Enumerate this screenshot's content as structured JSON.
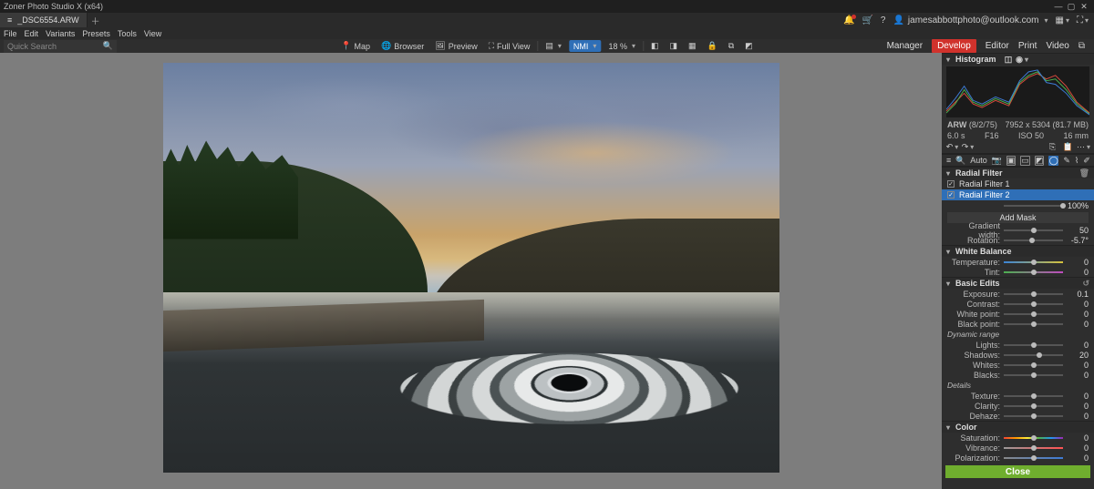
{
  "titlebar": {
    "app": "Zoner Photo Studio X (x64)"
  },
  "tab": {
    "filename": "_DSC6554.ARW"
  },
  "menu": [
    "File",
    "Edit",
    "Variants",
    "Presets",
    "Tools",
    "View"
  ],
  "search": {
    "placeholder": "Quick Search"
  },
  "center_tools": {
    "map": "Map",
    "browser": "Browser",
    "preview": "Preview",
    "fullview": "Full View",
    "zoom_pct": "18 %",
    "color_mode": "NMI"
  },
  "account": {
    "email": "jamesabbottphoto@outlook.com"
  },
  "modes": {
    "manager": "Manager",
    "develop": "Develop",
    "editor": "Editor",
    "print": "Print",
    "video": "Video"
  },
  "side": {
    "histogram_title": "Histogram",
    "file_meta": {
      "format": "ARW",
      "bits": "(8/2/75)",
      "dims": "7952 x 5304 (81.7 MB)",
      "shutter": "6.0 s",
      "aperture": "F16",
      "iso": "ISO 50",
      "focal": "16 mm"
    },
    "tool_auto": "Auto",
    "radial": {
      "title": "Radial Filter",
      "items": [
        "Radial Filter 1",
        "Radial Filter 2"
      ],
      "strength": "100%",
      "add_mask": "Add Mask",
      "gradient_width": {
        "label": "Gradient width:",
        "value": "50"
      },
      "rotation": {
        "label": "Rotation:",
        "value": "-5.7°"
      }
    },
    "wb": {
      "title": "White Balance",
      "temperature": {
        "label": "Temperature:",
        "value": "0"
      },
      "tint": {
        "label": "Tint:",
        "value": "0"
      }
    },
    "basic": {
      "title": "Basic Edits",
      "exposure": {
        "label": "Exposure:",
        "value": "0.1"
      },
      "contrast": {
        "label": "Contrast:",
        "value": "0"
      },
      "whitepoint": {
        "label": "White point:",
        "value": "0"
      },
      "blackpoint": {
        "label": "Black point:",
        "value": "0"
      },
      "dynamic": "Dynamic range",
      "lights": {
        "label": "Lights:",
        "value": "0"
      },
      "shadows": {
        "label": "Shadows:",
        "value": "20"
      },
      "whites": {
        "label": "Whites:",
        "value": "0"
      },
      "blacks": {
        "label": "Blacks:",
        "value": "0"
      },
      "details": "Details",
      "texture": {
        "label": "Texture:",
        "value": "0"
      },
      "clarity": {
        "label": "Clarity:",
        "value": "0"
      },
      "dehaze": {
        "label": "Dehaze:",
        "value": "0"
      }
    },
    "color": {
      "title": "Color",
      "saturation": {
        "label": "Saturation:",
        "value": "0"
      },
      "vibrance": {
        "label": "Vibrance:",
        "value": "0"
      },
      "polarization": {
        "label": "Polarization:",
        "value": "0"
      }
    },
    "close": "Close"
  }
}
